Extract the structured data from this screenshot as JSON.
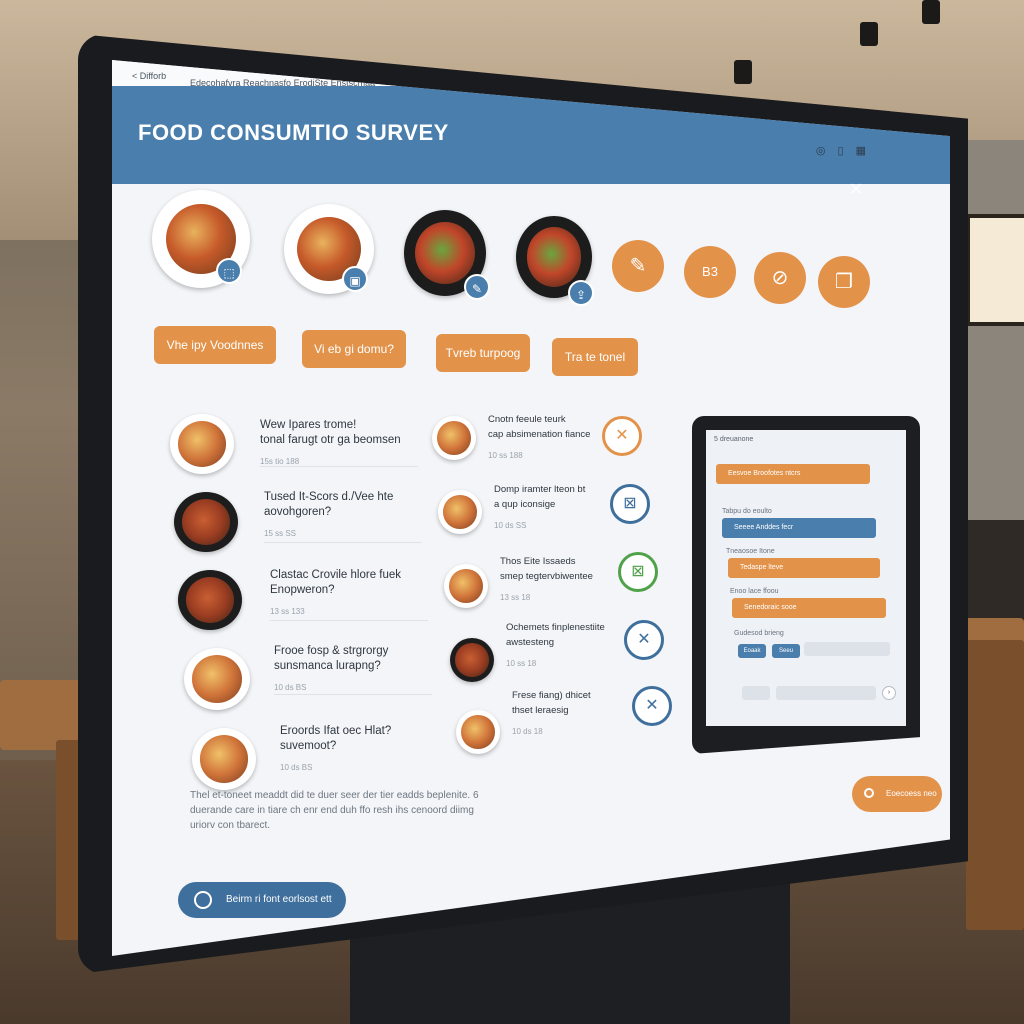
{
  "topbar": {
    "crumb": "< Difforb",
    "url": "Edecohafvra Reachnasfo ErodiSte Enstscmaa"
  },
  "header": {
    "title": "FOOD CONSUMTIO SURVEY",
    "close_icon": "×",
    "window_icons": [
      "◎",
      "▯",
      "▦"
    ]
  },
  "colors": {
    "accent_blue": "#4a7eac",
    "accent_orange": "#e3924a"
  },
  "top_dishes": [
    {
      "badge_icon": "crop-icon"
    },
    {
      "badge_icon": "image-icon"
    },
    {
      "badge_icon": "edit-icon"
    },
    {
      "badge_icon": "share-icon"
    }
  ],
  "top_actions": [
    {
      "icon": "ice-cream-icon",
      "glyph": "✎"
    },
    {
      "icon": "coin-icon",
      "glyph": "B3"
    },
    {
      "icon": "no-image-icon",
      "glyph": "⊘"
    },
    {
      "icon": "copy-icon",
      "glyph": "❐"
    }
  ],
  "pills": [
    "Vhe ipy Voodnnes",
    "Vi eb gi domu?",
    "Tvreb turpoog",
    "Tra te tonel"
  ],
  "left_rows": [
    {
      "q1": "Wew Ipares trome!",
      "q2": "tonal farugt otr ga beomsen",
      "meta": "15s tio 188"
    },
    {
      "q1": "Tused It-Scors d./Vee hte",
      "q2": "aovohgoren?",
      "meta": "15 ss SS"
    },
    {
      "q1": "Clastac Crovile hlore fuek",
      "q2": "Enopweron?",
      "meta": "13 ss 133"
    },
    {
      "q1": "Frooe fosp & strgrorgy",
      "q2": "sunsmanca lurapng?",
      "meta": "10 ds BS"
    },
    {
      "q1": "Eroords Ifat oec Hlat?",
      "q2": "suvemoot?",
      "meta": "10 ds BS"
    }
  ],
  "right_rows": [
    {
      "q1": "Cnotn feeule teurk",
      "q2": "cap absimenation fiance",
      "meta": "10 ss 188",
      "choice": "✕"
    },
    {
      "q1": "Domp iramter lteon bt",
      "q2": "a qup iconsige",
      "meta": "10 ds SS",
      "choice": "⊠"
    },
    {
      "q1": "Thos Eite Issaeds",
      "q2": "smep tegtervbiwentee",
      "meta": "13 ss 18",
      "choice": "⊠"
    },
    {
      "q1": "Ochemets finplenestiite",
      "q2": "awstesteng",
      "meta": "10 ss 18",
      "choice": "✕"
    },
    {
      "q1": "Frese fiang) dhicet",
      "q2": "thset leraesig",
      "meta": "10 ds 18",
      "choice": "✕"
    }
  ],
  "footer": {
    "text": "Thel et-toneet meaddt did te duer seer der tier eadds beplenite. 6 duerande care in tiare ch enr end duh ffo resh ihs cenoord diimg uriorv con tbarect.",
    "help_label": "Beirm ri font eorlsost ett",
    "search_label": "Eoecoess neo"
  },
  "tablet": {
    "title": "5 dreuanone",
    "bars": [
      {
        "label": "Eesvoe Broofotes ntcrs",
        "color": "#e3924a"
      },
      {
        "label": "Seeee Anddes fecr",
        "color": "#4a7eac"
      },
      {
        "label": "Tedaspe lteve",
        "color": "#e3924a"
      },
      {
        "label": "Senedoraic sooe",
        "color": "#e3924a"
      }
    ],
    "labels": [
      "Tabpu do eoulto",
      "Tneaosoe Itone",
      "Enoo lace ffoou",
      "Gudesod brieng"
    ],
    "buttons": [
      "Eoaak",
      "Seeu"
    ],
    "next": "›"
  }
}
